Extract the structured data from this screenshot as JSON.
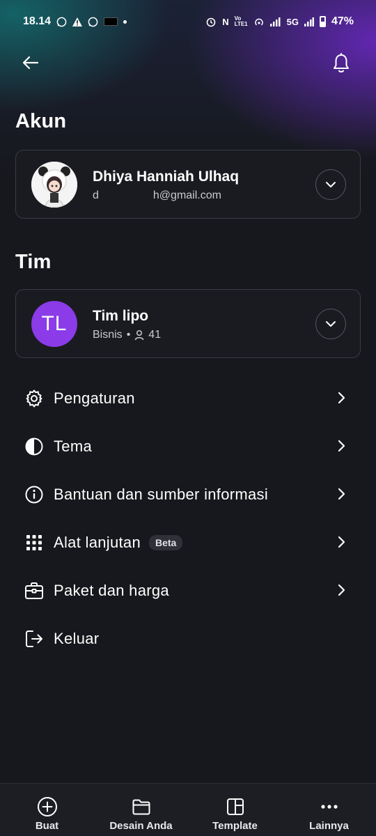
{
  "status_bar": {
    "time": "18.14",
    "lte_label": "Vo\nLTE1",
    "network": "5G",
    "battery": "47%",
    "battery_level": 0.47
  },
  "header": {
    "back_icon": "arrow-left-icon",
    "notification_icon": "bell-icon"
  },
  "account": {
    "section_title": "Akun",
    "name": "Dhiya Hanniah Ulhaq",
    "email_start": "d",
    "email_end": "h@gmail.com"
  },
  "team": {
    "section_title": "Tim",
    "initials": "TL",
    "name": "Tim lipo",
    "plan": "Bisnis",
    "separator": "•",
    "member_count": "41",
    "avatar_color": "#8b3be8"
  },
  "menu": {
    "items": [
      {
        "label": "Pengaturan",
        "icon": "gear-icon"
      },
      {
        "label": "Tema",
        "icon": "contrast-icon"
      },
      {
        "label": "Bantuan dan sumber informasi",
        "icon": "info-icon"
      },
      {
        "label": "Alat lanjutan",
        "icon": "apps-grid-icon",
        "badge": "Beta"
      },
      {
        "label": "Paket dan harga",
        "icon": "briefcase-icon"
      },
      {
        "label": "Keluar",
        "icon": "logout-icon"
      }
    ]
  },
  "bottom_nav": {
    "items": [
      {
        "label": "Buat",
        "icon": "plus-circle-icon"
      },
      {
        "label": "Desain Anda",
        "icon": "folder-icon"
      },
      {
        "label": "Template",
        "icon": "template-icon"
      },
      {
        "label": "Lainnya",
        "icon": "more-dots-icon"
      }
    ]
  },
  "colors": {
    "background": "#17181d",
    "card_border": "#3a3c44",
    "accent_purple": "#8b3be8"
  }
}
